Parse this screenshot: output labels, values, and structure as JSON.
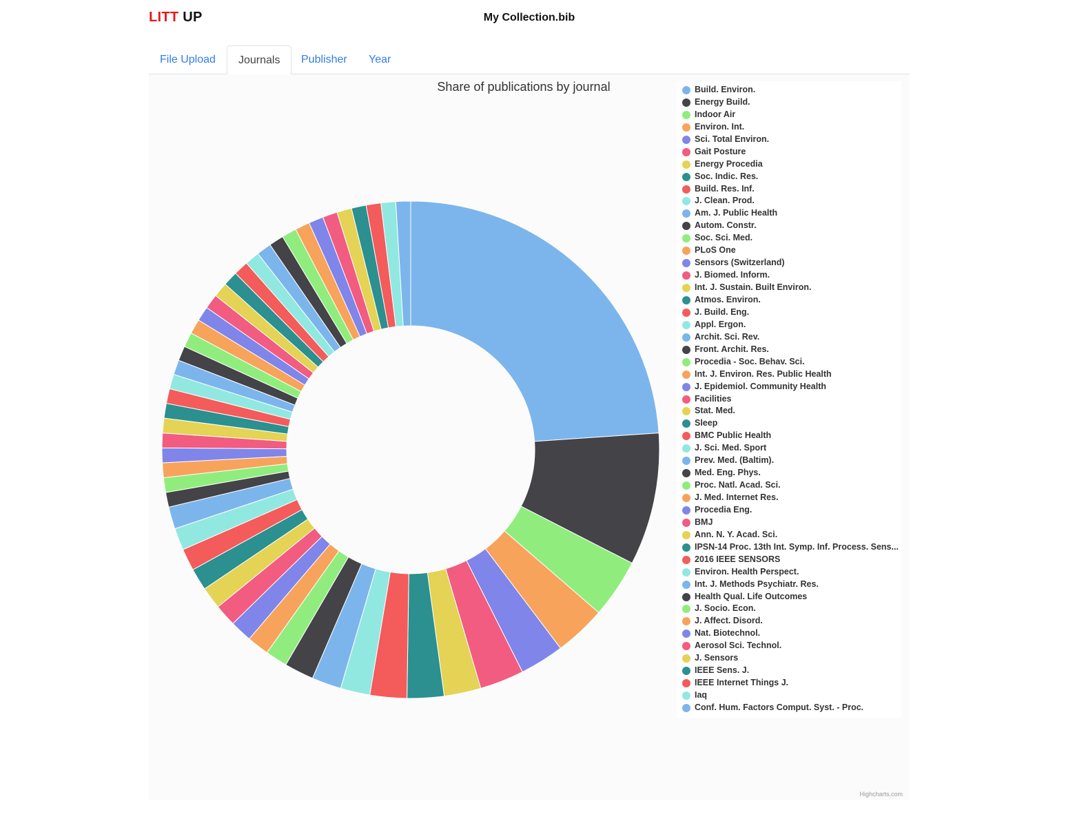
{
  "header": {
    "brand_part1": "LITT",
    "brand_part2": "UP",
    "file_name": "My Collection.bib"
  },
  "tabs": [
    {
      "label": "File Upload",
      "active": false
    },
    {
      "label": "Journals",
      "active": true
    },
    {
      "label": "Publisher",
      "active": false
    },
    {
      "label": "Year",
      "active": false
    }
  ],
  "credits": "Highcharts.com",
  "colors": [
    "#7cb5ec",
    "#434348",
    "#90ed7d",
    "#f7a35c",
    "#8085e9",
    "#f15c80",
    "#e4d354",
    "#2b908f",
    "#f45b5b",
    "#91e8e1"
  ],
  "chart_data": {
    "type": "pie",
    "variant": "donut",
    "title": "Share of publications by journal",
    "legend_position": "right",
    "slices": [
      {
        "name": "Build. Environ.",
        "value": 25
      },
      {
        "name": "Energy Build.",
        "value": 9
      },
      {
        "name": "Indoor Air",
        "value": 4
      },
      {
        "name": "Environ. Int.",
        "value": 3.5
      },
      {
        "name": "Sci. Total Environ.",
        "value": 3
      },
      {
        "name": "Gait Posture",
        "value": 3
      },
      {
        "name": "Energy Procedia",
        "value": 2.5
      },
      {
        "name": "Soc. Indic. Res.",
        "value": 2.5
      },
      {
        "name": "Build. Res. Inf.",
        "value": 2.5
      },
      {
        "name": "J. Clean. Prod.",
        "value": 2
      },
      {
        "name": "Am. J. Public Health",
        "value": 2
      },
      {
        "name": "Autom. Constr.",
        "value": 2
      },
      {
        "name": "Soc. Sci. Med.",
        "value": 1.5
      },
      {
        "name": "PLoS One",
        "value": 1.5
      },
      {
        "name": "Sensors (Switzerland)",
        "value": 1.5
      },
      {
        "name": "J. Biomed. Inform.",
        "value": 1.5
      },
      {
        "name": "Int. J. Sustain. Built Environ.",
        "value": 1.5
      },
      {
        "name": "Atmos. Environ.",
        "value": 1.5
      },
      {
        "name": "J. Build. Eng.",
        "value": 1.5
      },
      {
        "name": "Appl. Ergon.",
        "value": 1.5
      },
      {
        "name": "Archit. Sci. Rev.",
        "value": 1.5
      },
      {
        "name": "Front. Archit. Res.",
        "value": 1
      },
      {
        "name": "Procedia - Soc. Behav. Sci.",
        "value": 1
      },
      {
        "name": "Int. J. Environ. Res. Public Health",
        "value": 1
      },
      {
        "name": "J. Epidemiol. Community Health",
        "value": 1
      },
      {
        "name": "Facilities",
        "value": 1
      },
      {
        "name": "Stat. Med.",
        "value": 1
      },
      {
        "name": "Sleep",
        "value": 1
      },
      {
        "name": "BMC Public Health",
        "value": 1
      },
      {
        "name": "J. Sci. Med. Sport",
        "value": 1
      },
      {
        "name": "Prev. Med. (Baltim).",
        "value": 1
      },
      {
        "name": "Med. Eng. Phys.",
        "value": 1
      },
      {
        "name": "Proc. Natl. Acad. Sci.",
        "value": 1
      },
      {
        "name": "J. Med. Internet Res.",
        "value": 1
      },
      {
        "name": "Procedia Eng.",
        "value": 1
      },
      {
        "name": "BMJ",
        "value": 1
      },
      {
        "name": "Ann. N. Y. Acad. Sci.",
        "value": 1
      },
      {
        "name": "IPSN-14 Proc. 13th Int. Symp. Inf. Process. Sens...",
        "value": 1
      },
      {
        "name": "2016 IEEE SENSORS",
        "value": 1
      },
      {
        "name": "Environ. Health Perspect.",
        "value": 1
      },
      {
        "name": "Int. J. Methods Psychiatr. Res.",
        "value": 1
      },
      {
        "name": "Health Qual. Life Outcomes",
        "value": 1
      },
      {
        "name": "J. Socio. Econ.",
        "value": 1
      },
      {
        "name": "J. Affect. Disord.",
        "value": 1
      },
      {
        "name": "Nat. Biotechnol.",
        "value": 1
      },
      {
        "name": "Aerosol Sci. Technol.",
        "value": 1
      },
      {
        "name": "J. Sensors",
        "value": 1
      },
      {
        "name": "IEEE Sens. J.",
        "value": 1
      },
      {
        "name": "IEEE Internet Things J.",
        "value": 1
      },
      {
        "name": "Iaq",
        "value": 1
      },
      {
        "name": "Conf. Hum. Factors Comput. Syst. - Proc.",
        "value": 1
      }
    ]
  }
}
